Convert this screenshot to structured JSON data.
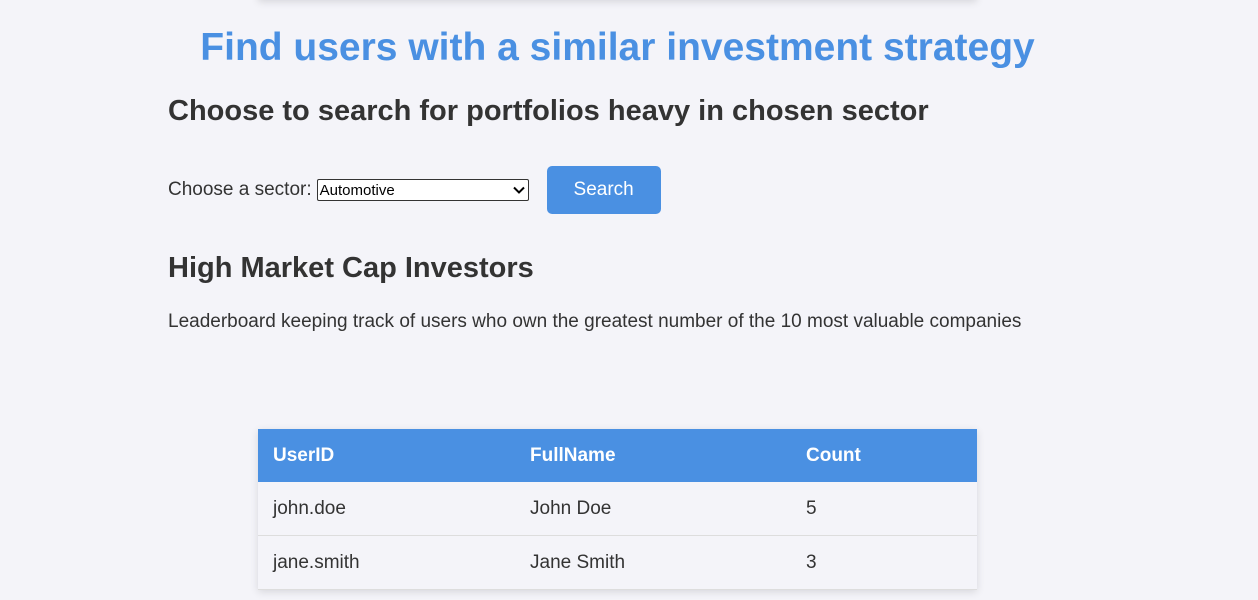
{
  "page": {
    "title": "Find users with a similar investment strategy",
    "sector_search_heading": "Choose to search for portfolios heavy in chosen sector"
  },
  "sector_form": {
    "label": "Choose a sector:",
    "selected_sector": "Automotive",
    "search_button_label": "Search"
  },
  "leaderboard": {
    "heading": "High Market Cap Investors",
    "description": "Leaderboard keeping track of users who own the greatest number of the 10 most valuable companies",
    "columns": [
      "UserID",
      "FullName",
      "Count"
    ],
    "rows": [
      {
        "user_id": "john.doe",
        "full_name": "John Doe",
        "count": "5"
      },
      {
        "user_id": "jane.smith",
        "full_name": "Jane Smith",
        "count": "3"
      }
    ]
  },
  "colors": {
    "accent": "#4a90e2",
    "background": "#f4f4f9",
    "text": "#333333"
  }
}
